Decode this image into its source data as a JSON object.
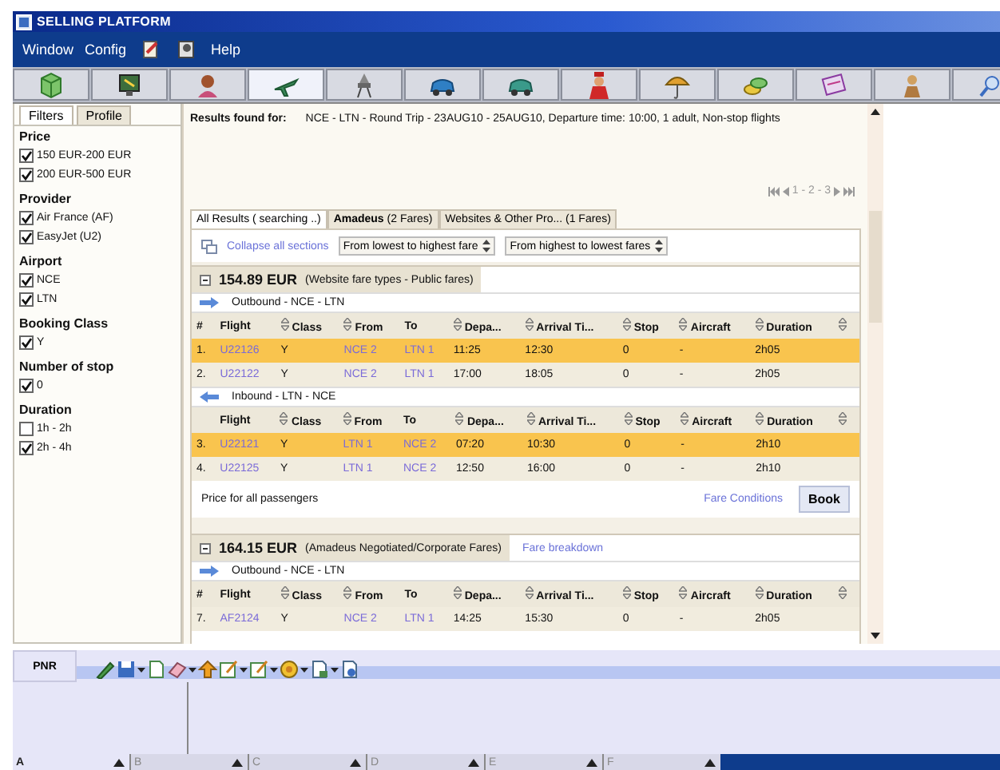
{
  "window": {
    "title": "SELLING PLATFORM"
  },
  "menu": [
    {
      "kind": "text",
      "label": "Window"
    },
    {
      "kind": "text",
      "label": "Config"
    },
    {
      "kind": "icon"
    },
    {
      "kind": "icon"
    },
    {
      "kind": "text",
      "label": "Help"
    }
  ],
  "toolbar": [
    {
      "selected": false
    },
    {
      "selected": false
    },
    {
      "selected": false
    },
    {
      "selected": true
    },
    {
      "selected": false
    },
    {
      "selected": false
    },
    {
      "selected": false
    },
    {
      "selected": false
    },
    {
      "selected": false
    },
    {
      "selected": false
    },
    {
      "selected": false
    },
    {
      "selected": false
    },
    {
      "selected": false
    }
  ],
  "sidebar": {
    "tabs": [
      {
        "label": "Filters",
        "selected": true
      },
      {
        "label": "Profile",
        "selected": false
      }
    ],
    "groups": [
      {
        "title": "Price",
        "options": [
          {
            "label": "150 EUR-200 EUR",
            "checked": true
          },
          {
            "label": "200 EUR-500 EUR",
            "checked": true
          }
        ]
      },
      {
        "title": "Provider",
        "options": [
          {
            "label": "Air France (AF)",
            "checked": true
          },
          {
            "label": "EasyJet (U2)",
            "checked": true
          }
        ]
      },
      {
        "title": "Airport",
        "options": [
          {
            "label": "NCE",
            "checked": true
          },
          {
            "label": "LTN",
            "checked": true
          }
        ]
      },
      {
        "title": "Booking Class",
        "options": [
          {
            "label": "Y",
            "checked": true
          }
        ]
      },
      {
        "title": "Number of stop",
        "options": [
          {
            "label": "0",
            "checked": true
          }
        ]
      },
      {
        "title": "Duration",
        "options": [
          {
            "label": "1h - 2h",
            "checked": false
          },
          {
            "label": "2h - 4h",
            "checked": true
          }
        ]
      }
    ]
  },
  "results": {
    "label": "Results found for:",
    "query": "NCE - LTN  - Round Trip - 23AUG10  - 25AUG10,  Departure time: 10:00, 1 adult,  Non-stop flights",
    "pages": "1 - 2 - 3",
    "tabs": [
      {
        "label": "All Results ( searching ..)",
        "selected": true
      },
      {
        "label": "**Amadeus** (2 Fares)",
        "selected": false
      },
      {
        "label": "Websites & Other Pro... (1   Fares)",
        "selected": false
      }
    ],
    "collapse_link": "Collapse all sections",
    "sorts": [
      "From lowest to highest fare",
      "From highest to lowest fares"
    ],
    "fares": [
      {
        "price": "154.89 EUR",
        "note": "(Website fare types - Public fares)",
        "legs": [
          {
            "kind": "outbound",
            "label": "Outbound - NCE - LTN",
            "columns": [
              {
                "label": "#",
                "kind": "plain"
              },
              {
                "label": "Flight",
                "kind": "plain"
              },
              {
                "label": "Class",
                "kind": "sortable"
              },
              {
                "label": "From",
                "kind": "sortable"
              },
              {
                "label": "To",
                "kind": "plain"
              },
              {
                "label": "Depa...",
                "kind": "sortable"
              },
              {
                "label": "Arrival Ti...",
                "kind": "sortable"
              },
              {
                "label": "Stop",
                "kind": "sortable"
              },
              {
                "label": "Aircraft",
                "kind": "sortable"
              },
              {
                "label": "Duration",
                "kind": "sortable"
              },
              {
                "kind": "sortable"
              }
            ],
            "rows": [
              {
                "selected": true,
                "cells": [
                  "1.",
                  "U22126",
                  "Y",
                  "NCE 2",
                  "LTN 1",
                  "11:25",
                  "12:30",
                  "0",
                  "-",
                  "2h05"
                ]
              },
              {
                "selected": false,
                "cells": [
                  "2.",
                  "U22122",
                  "Y",
                  "NCE 2",
                  "LTN 1",
                  "17:00",
                  "18:05",
                  "0",
                  "-",
                  "2h05"
                ]
              }
            ]
          },
          {
            "kind": "inbound",
            "label": "Inbound - LTN - NCE",
            "columns": [
              {
                "kind": "plain"
              },
              {
                "label": "Flight",
                "kind": "plain"
              },
              {
                "label": "Class",
                "kind": "sortable"
              },
              {
                "label": "From",
                "kind": "sortable"
              },
              {
                "label": "To",
                "kind": "plain"
              },
              {
                "label": "Depa...",
                "kind": "sortable"
              },
              {
                "label": "Arrival Ti...",
                "kind": "sortable"
              },
              {
                "label": "Stop",
                "kind": "sortable"
              },
              {
                "label": "Aircraft",
                "kind": "sortable"
              },
              {
                "label": "Duration",
                "kind": "sortable"
              },
              {
                "kind": "sortable"
              }
            ],
            "rows": [
              {
                "selected": true,
                "cells": [
                  "3.",
                  "U22121",
                  "Y",
                  "LTN 1",
                  "NCE 2",
                  "07:20",
                  "10:30",
                  "0",
                  "-",
                  "2h10"
                ]
              },
              {
                "selected": false,
                "cells": [
                  "4.",
                  "U22125",
                  "Y",
                  "LTN 1",
                  "NCE 2",
                  "12:50",
                  "16:00",
                  "0",
                  "-",
                  "2h10"
                ]
              }
            ]
          }
        ],
        "footer": {
          "text": "Price for all passengers",
          "link": "Fare Conditions",
          "button": "Book"
        }
      },
      {
        "price": "164.15 EUR",
        "note": "(Amadeus Negotiated/Corporate Fares)",
        "breakdown_link": "Fare breakdown",
        "legs": [
          {
            "kind": "outbound",
            "label": "Outbound - NCE - LTN",
            "columns": [
              {
                "label": "#",
                "kind": "plain"
              },
              {
                "label": "Flight",
                "kind": "plain"
              },
              {
                "label": "Class",
                "kind": "sortable"
              },
              {
                "label": "From",
                "kind": "sortable"
              },
              {
                "label": "To",
                "kind": "plain"
              },
              {
                "label": "Depa...",
                "kind": "sortable"
              },
              {
                "label": "Arrival Ti...",
                "kind": "sortable"
              },
              {
                "label": "Stop",
                "kind": "sortable"
              },
              {
                "label": "Aircraft",
                "kind": "sortable"
              },
              {
                "label": "Duration",
                "kind": "sortable"
              },
              {
                "kind": "sortable"
              }
            ],
            "rows": [
              {
                "selected": false,
                "cells": [
                  "7.",
                  "AF2124",
                  "Y",
                  "NCE 2",
                  "LTN 1",
                  "14:25",
                  "15:30",
                  "0",
                  "-",
                  "2h05"
                ]
              }
            ]
          }
        ]
      }
    ]
  },
  "pnr": {
    "tab": "PNR",
    "sheets": [
      "A",
      "B",
      "C",
      "D",
      "E",
      "F"
    ]
  }
}
